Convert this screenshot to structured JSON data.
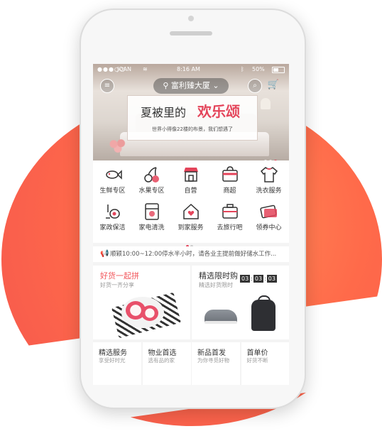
{
  "status_bar": {
    "dots": "●●●○○",
    "carrier": "JOAN",
    "time": "8:16 AM",
    "battery": "50%",
    "battery_level": 0.5
  },
  "header": {
    "location": "富利臻大厦",
    "menu_icon": "menu-icon",
    "search_icon": "search-icon",
    "cart_icon": "cart-icon"
  },
  "banner": {
    "title_left": "夏被里的",
    "title_right": "欢乐颂",
    "subtitle": "世界小得像22楼的布景，我们想遇了",
    "slide_count": 3,
    "active_slide": 3
  },
  "services": [
    {
      "label": "生鲜专区",
      "icon": "fish-icon"
    },
    {
      "label": "水果专区",
      "icon": "cherry-icon"
    },
    {
      "label": "自营",
      "icon": "store-icon"
    },
    {
      "label": "商超",
      "icon": "shopping-bag-icon"
    },
    {
      "label": "洗衣服务",
      "icon": "shirt-icon"
    },
    {
      "label": "家政保洁",
      "icon": "vacuum-icon"
    },
    {
      "label": "家电清洗",
      "icon": "appliance-icon"
    },
    {
      "label": "到家服务",
      "icon": "home-heart-icon"
    },
    {
      "label": "去旅行吧",
      "icon": "suitcase-icon"
    },
    {
      "label": "领券中心",
      "icon": "ticket-icon"
    }
  ],
  "notice": {
    "text": "顺颖10:00~12:00停水半小时，请各业主提前做好储水工作..."
  },
  "promos": {
    "left": {
      "title": "好货一起拼",
      "subtitle": "好货一齐分享"
    },
    "right": {
      "title": "精选限时购",
      "subtitle": "精选好货限时",
      "countdown": [
        "03",
        "03",
        "03"
      ]
    }
  },
  "bottom_row": [
    {
      "title": "精选服务",
      "subtitle": "享受好时光"
    },
    {
      "title": "物业首选",
      "subtitle": "选有品的家"
    },
    {
      "title": "新品首发",
      "subtitle": "为你寻觅好物"
    },
    {
      "title": "首单价",
      "subtitle": "好货不断"
    }
  ],
  "colors": {
    "accent": "#e4445a",
    "blob": "#ff6a4a"
  }
}
